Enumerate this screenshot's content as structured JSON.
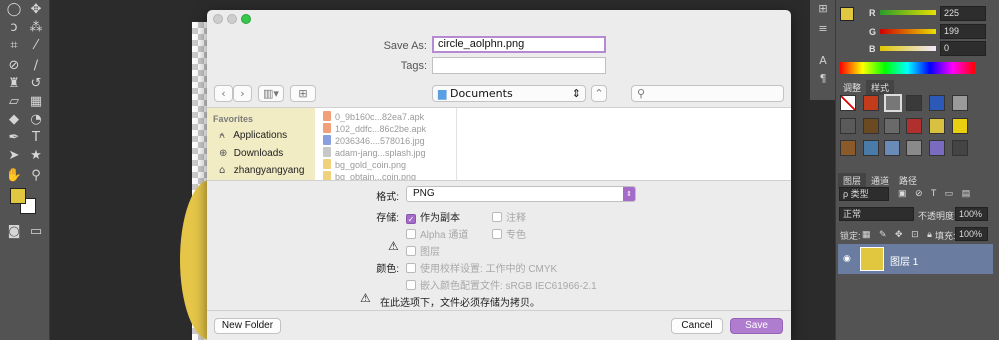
{
  "photoshop": {
    "color_panel": {
      "channels": [
        {
          "label": "R",
          "value": "225"
        },
        {
          "label": "G",
          "value": "199"
        },
        {
          "label": "B",
          "value": "0"
        }
      ]
    },
    "panel_tabs_adjust": [
      "调整",
      "样式"
    ],
    "panel_tabs_layers": [
      "图层",
      "通道",
      "路径"
    ],
    "layers": {
      "filter_label": "ρ 类型",
      "blend_mode": "正常",
      "opacity_label": "不透明度:",
      "opacity_value": "100%",
      "lock_label": "锁定:",
      "fill_label": "填充:",
      "fill_value": "100%",
      "layer_name": "图层 1"
    },
    "colors": {
      "accent_yellow": "#e1c73f",
      "accent_purple": "#a46cc8"
    }
  },
  "dialog": {
    "save_as_label": "Save As:",
    "save_as_value": "circle_aolphn.png",
    "tags_label": "Tags:",
    "tags_value": "",
    "location": "Documents",
    "sidebar": {
      "title": "Favorites",
      "items": [
        {
          "label": "Applications",
          "icon": "applications-icon"
        },
        {
          "label": "Downloads",
          "icon": "downloads-icon"
        },
        {
          "label": "zhangyangyang",
          "icon": "home-icon"
        }
      ]
    },
    "files": [
      {
        "name": "0_9b160c...82ea7.apk",
        "color": "#f2a07a"
      },
      {
        "name": "102_ddfc...86c2be.apk",
        "color": "#f2a07a"
      },
      {
        "name": "2036346....578016.jpg",
        "color": "#8a9ee0"
      },
      {
        "name": "adam-jang...splash.jpg",
        "color": "#c7c7c7"
      },
      {
        "name": "bg_gold_coin.png",
        "color": "#efd27b"
      },
      {
        "name": "bg_obtain...coin.png",
        "color": "#efd27b"
      }
    ],
    "options": {
      "format_label": "格式:",
      "format_value": "PNG",
      "save_label": "存储:",
      "as_copy": "作为副本",
      "annotations": "注释",
      "alpha": "Alpha 通道",
      "spot": "专色",
      "layers": "图层",
      "color_label": "颜色:",
      "proof": "使用校样设置: 工作中的 CMYK",
      "embed": "嵌入颜色配置文件: sRGB IEC61966-2.1",
      "warning": "在此选项下，文件必须存储为拷贝。"
    },
    "buttons": {
      "new_folder": "New Folder",
      "cancel": "Cancel",
      "save": "Save"
    }
  }
}
